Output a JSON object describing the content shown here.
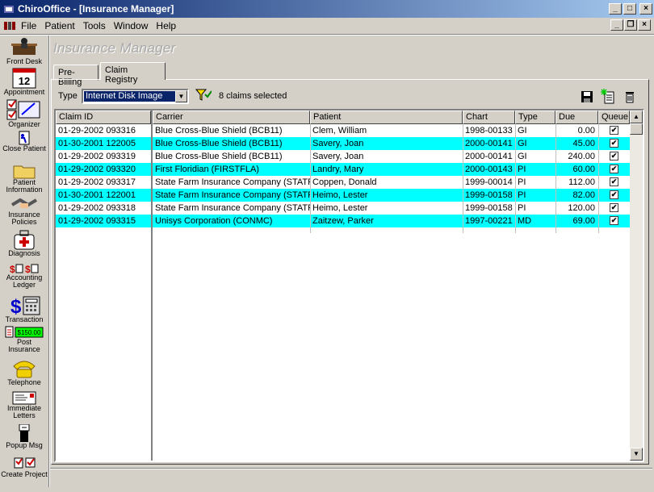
{
  "window": {
    "title": "ChiroOffice - [Insurance Manager]"
  },
  "menu": [
    "File",
    "Patient",
    "Tools",
    "Window",
    "Help"
  ],
  "sidebar": [
    {
      "label": "Front Desk",
      "icon": "front-desk-icon"
    },
    {
      "label": "Appointment",
      "icon": "appointment-calendar-icon",
      "badge": "12"
    },
    {
      "label": "Organizer",
      "icon": "organizer-icon"
    },
    {
      "label": "Close Patient",
      "icon": "close-patient-icon"
    },
    {
      "label": "Patient Information",
      "icon": "folder-icon"
    },
    {
      "label": "Insurance Policies",
      "icon": "handshake-icon"
    },
    {
      "label": "Diagnosis",
      "icon": "medical-bag-icon"
    },
    {
      "label": "Accounting Ledger",
      "icon": "ledger-icon"
    },
    {
      "label": "Transaction",
      "icon": "dollar-calculator-icon"
    },
    {
      "label": "Post Insurance",
      "icon": "post-insurance-icon",
      "badge": "$150.00"
    },
    {
      "label": "Telephone",
      "icon": "telephone-icon"
    },
    {
      "label": "Immediate Letters",
      "icon": "letter-icon"
    },
    {
      "label": "Popup Msg",
      "icon": "popup-msg-icon"
    },
    {
      "label": "Create Project",
      "icon": "create-project-icon"
    }
  ],
  "header": {
    "title": "Insurance Manager"
  },
  "tabs": [
    {
      "label": "Pre-Billing"
    },
    {
      "label": "Claim Registry"
    }
  ],
  "toolbar": {
    "type_label": "Type",
    "type_value": "Internet Disk Image",
    "claims_selected": "8 claims selected"
  },
  "table": {
    "columns": [
      "Claim ID",
      "Carrier",
      "Patient",
      "Chart",
      "Type",
      "Due",
      "Queue"
    ],
    "rows": [
      {
        "claim_id": "01-29-2002 093316",
        "carrier": "Blue Cross-Blue Shield (BCB11)",
        "patient": "Clem, William",
        "chart": "1998-00133",
        "type": "GI",
        "due": "0.00",
        "queue": true
      },
      {
        "claim_id": "01-30-2001 122005",
        "carrier": "Blue Cross-Blue Shield (BCB11)",
        "patient": "Savery, Joan",
        "chart": "2000-00141",
        "type": "GI",
        "due": "45.00",
        "queue": true
      },
      {
        "claim_id": "01-29-2002 093319",
        "carrier": "Blue Cross-Blue Shield (BCB11)",
        "patient": "Savery, Joan",
        "chart": "2000-00141",
        "type": "GI",
        "due": "240.00",
        "queue": true
      },
      {
        "claim_id": "01-29-2002 093320",
        "carrier": "First Floridian (FIRSTFLA)",
        "patient": "Landry, Mary",
        "chart": "2000-00143",
        "type": "PI",
        "due": "60.00",
        "queue": true
      },
      {
        "claim_id": "01-29-2002 093317",
        "carrier": "State Farm Insurance Company (STATF",
        "patient": "Coppen, Donald",
        "chart": "1999-00014",
        "type": "PI",
        "due": "112.00",
        "queue": true
      },
      {
        "claim_id": "01-30-2001 122001",
        "carrier": "State Farm Insurance Company (STATF",
        "patient": "Heimo, Lester",
        "chart": "1999-00158",
        "type": "PI",
        "due": "82.00",
        "queue": true
      },
      {
        "claim_id": "01-29-2002 093318",
        "carrier": "State Farm Insurance Company (STATF",
        "patient": "Heimo, Lester",
        "chart": "1999-00158",
        "type": "PI",
        "due": "120.00",
        "queue": true
      },
      {
        "claim_id": "01-29-2002 093315",
        "carrier": "Unisys Corporation (CONMC)",
        "patient": "Zaitzew, Parker",
        "chart": "1997-00221",
        "type": "MD",
        "due": "69.00",
        "queue": true
      }
    ]
  },
  "colors": {
    "row_alt": "#00ffff",
    "title_bar": "#0a246a",
    "selection": "#0a246a"
  }
}
